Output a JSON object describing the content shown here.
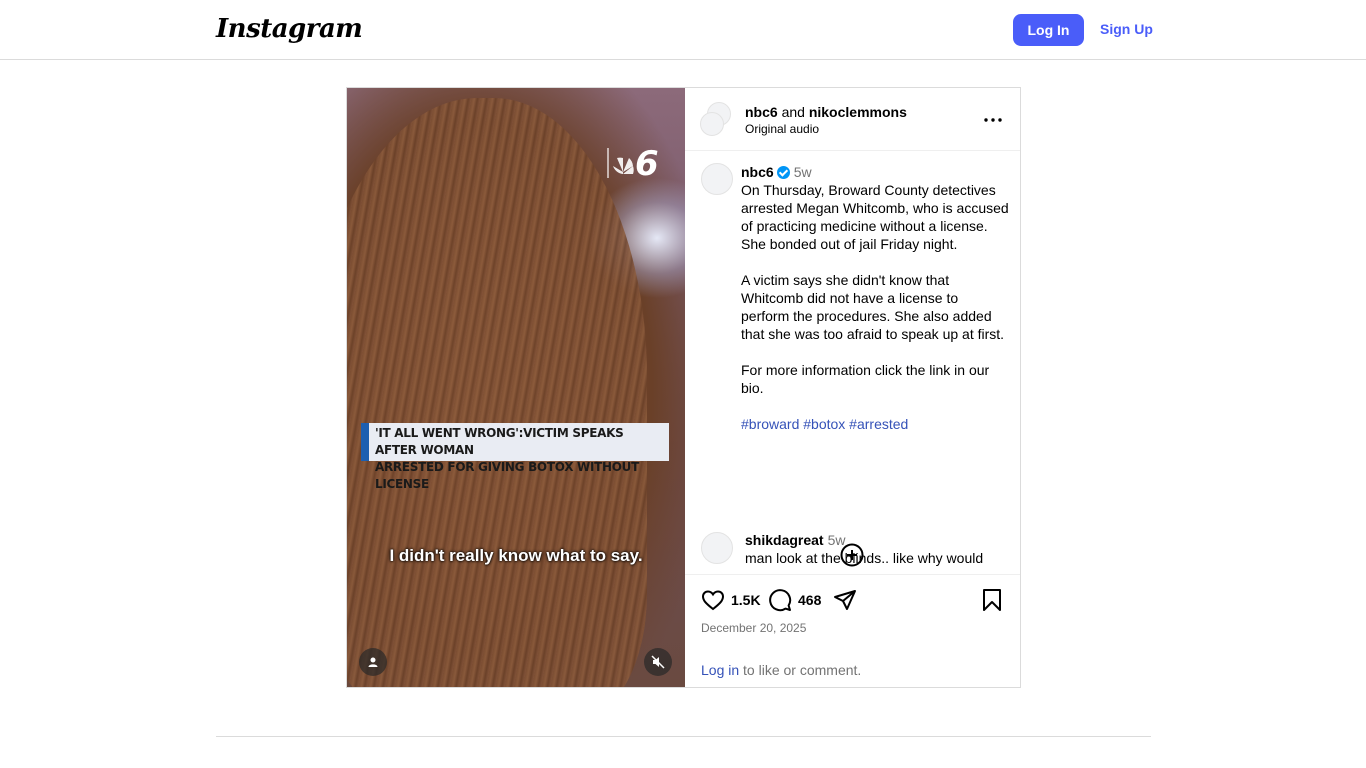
{
  "nav": {
    "logo": "Instagram",
    "login_label": "Log In",
    "signup_label": "Sign Up"
  },
  "video": {
    "chyron_line1": "'IT ALL WENT WRONG':VICTIM SPEAKS AFTER WOMAN",
    "chyron_line2": "ARRESTED FOR GIVING BOTOX WITHOUT LICENSE",
    "caption": "I didn't really know what to say.",
    "brand_mark": "nbc6-peacock-logo",
    "tag_icon": "person-icon",
    "mute_icon": "speaker-muted-icon"
  },
  "header": {
    "author1": "nbc6",
    "and": "and",
    "author2": "nikoclemmons",
    "audio": "Original audio"
  },
  "post": {
    "user": "nbc6",
    "time": "5w",
    "p1": "On Thursday, Broward County detectives arrested Megan Whitcomb, who is accused of practicing medicine without a license. She bonded out of jail Friday night.",
    "p2": "A victim says she didn't know that Whitcomb did not have a license to perform the procedures. She also added that she was too afraid to speak up at first.",
    "p3": "For more information click the link in our bio.",
    "tags": "#broward #botox #arrested"
  },
  "comments": [
    {
      "user": "shikdagreat",
      "time": "5w",
      "text": "man look at the blinds.. like why would"
    }
  ],
  "actions": {
    "likes": "1.5K",
    "comments": "468",
    "date": "December 20, 2025",
    "login_link": "Log in",
    "login_suffix": " to like or comment."
  },
  "colors": {
    "accent": "#4a5df9",
    "link": "#3552b8",
    "verified": "#0095f6"
  }
}
